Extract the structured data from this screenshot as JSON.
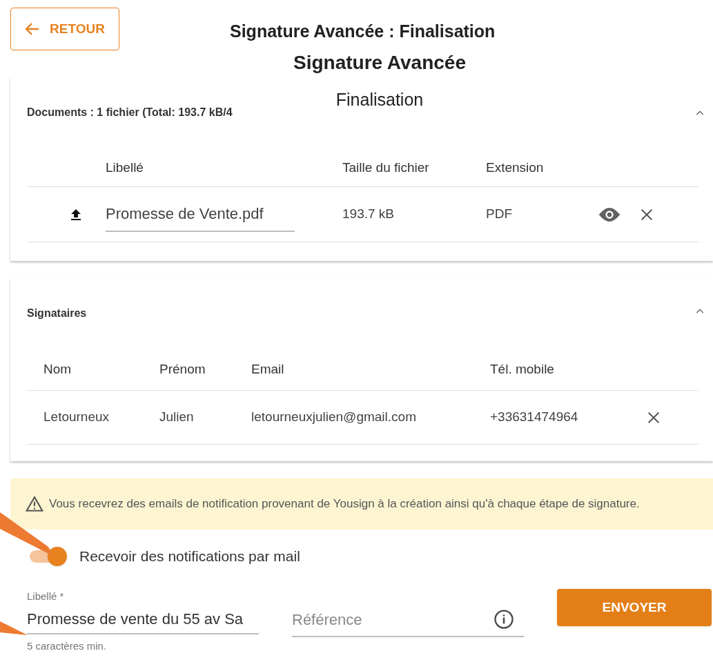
{
  "back_button": {
    "label": "RETOUR"
  },
  "title": "Signature Avancée : Finalisation",
  "overlay": {
    "title": "Signature Avancée",
    "subtitle": "Finalisation"
  },
  "documents": {
    "header": "Documents : 1 fichier (Total: 193.7 kB/4",
    "expanded": true,
    "columns": [
      "Libellé",
      "Taille du fichier",
      "Extension"
    ],
    "rows": [
      {
        "label": "Promesse de Vente.pdf",
        "size": "193.7 kB",
        "extension": "PDF"
      }
    ]
  },
  "signers": {
    "header": "Signataires",
    "expanded": true,
    "columns": [
      "Nom",
      "Prénom",
      "Email",
      "Tél. mobile"
    ],
    "rows": [
      {
        "last_name": "Letourneux",
        "first_name": "Julien",
        "email": "letourneuxjulien@gmail.com",
        "phone": "+33631474964"
      }
    ]
  },
  "warning": "Vous recevrez des emails de notification provenant de Yousign à la création ainsi qu'à chaque étape de signature.",
  "notify_toggle": {
    "label": "Recevoir des notifications par mail",
    "on": true
  },
  "form": {
    "libelle": {
      "label": "Libellé *",
      "value": "Promesse de vente du 55 av Sa",
      "hint": "5 caractères min."
    },
    "reference": {
      "placeholder": "Référence"
    }
  },
  "send_button": {
    "label": "ENVOYER"
  }
}
